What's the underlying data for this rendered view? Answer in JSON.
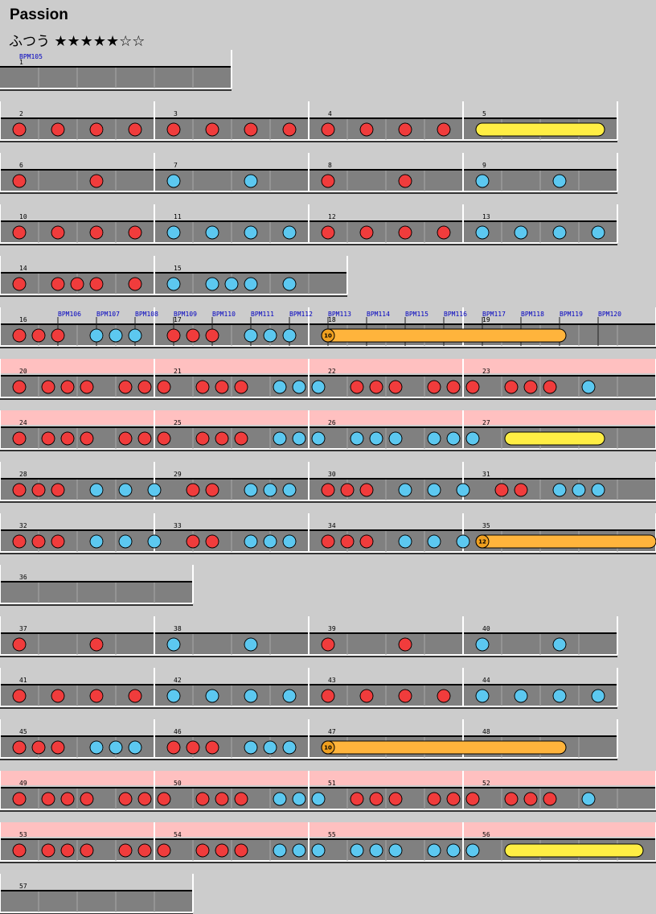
{
  "song": {
    "title": "Passion"
  },
  "difficulty": {
    "course": "ふつう",
    "stars": "★★★★★☆☆"
  },
  "colors": {
    "background": "#cccccc",
    "lane": "#808080",
    "gogo": "#ffc0c0",
    "don": "#f03c3c",
    "ka": "#5cc8f0",
    "drumroll": "#ffee44",
    "balloon": "#ffb43c",
    "barline": "#ffffff"
  },
  "icon_names": [
    "don-note-icon",
    "ka-note-icon",
    "drumroll-icon",
    "balloon-icon"
  ],
  "rows": [
    {
      "beats": 6,
      "gogo": false,
      "measures": [
        {
          "num": "1",
          "bpm": "BPM105",
          "beats": 6
        }
      ],
      "notes": [],
      "rolls": [],
      "bpm_marks": []
    },
    {
      "beats": 16,
      "gogo": false,
      "measures": [
        {
          "num": "2",
          "beats": 4
        },
        {
          "num": "3",
          "beats": 4
        },
        {
          "num": "4",
          "beats": 4
        },
        {
          "num": "5",
          "beats": 4
        }
      ],
      "notes": [
        [
          0,
          "d"
        ],
        [
          1,
          "d"
        ],
        [
          2,
          "d"
        ],
        [
          3,
          "d"
        ],
        [
          4,
          "d"
        ],
        [
          5,
          "d"
        ],
        [
          6,
          "d"
        ],
        [
          7,
          "d"
        ],
        [
          8,
          "d"
        ],
        [
          9,
          "d"
        ],
        [
          10,
          "d"
        ],
        [
          11,
          "d"
        ]
      ],
      "rolls": [
        {
          "type": "roll",
          "start": 12,
          "end": 15
        }
      ],
      "bpm_marks": []
    },
    {
      "beats": 16,
      "gogo": false,
      "measures": [
        {
          "num": "6",
          "beats": 4
        },
        {
          "num": "7",
          "beats": 4
        },
        {
          "num": "8",
          "beats": 4
        },
        {
          "num": "9",
          "beats": 4
        }
      ],
      "notes": [
        [
          0,
          "d"
        ],
        [
          2,
          "d"
        ],
        [
          4,
          "k"
        ],
        [
          6,
          "k"
        ],
        [
          8,
          "d"
        ],
        [
          10,
          "d"
        ],
        [
          12,
          "k"
        ],
        [
          14,
          "k"
        ]
      ],
      "rolls": [],
      "bpm_marks": []
    },
    {
      "beats": 16,
      "gogo": false,
      "measures": [
        {
          "num": "10",
          "beats": 4
        },
        {
          "num": "11",
          "beats": 4
        },
        {
          "num": "12",
          "beats": 4
        },
        {
          "num": "13",
          "beats": 4
        }
      ],
      "notes": [
        [
          0,
          "d"
        ],
        [
          1,
          "d"
        ],
        [
          2,
          "d"
        ],
        [
          3,
          "d"
        ],
        [
          4,
          "k"
        ],
        [
          5,
          "k"
        ],
        [
          6,
          "k"
        ],
        [
          7,
          "k"
        ],
        [
          8,
          "d"
        ],
        [
          9,
          "d"
        ],
        [
          10,
          "d"
        ],
        [
          11,
          "d"
        ],
        [
          12,
          "k"
        ],
        [
          13,
          "k"
        ],
        [
          14,
          "k"
        ],
        [
          15,
          "k"
        ]
      ],
      "rolls": [],
      "bpm_marks": []
    },
    {
      "beats": 9,
      "gogo": false,
      "measures": [
        {
          "num": "14",
          "beats": 4
        },
        {
          "num": "15",
          "beats": 5
        }
      ],
      "notes": [
        [
          0,
          "d"
        ],
        [
          1,
          "d"
        ],
        [
          1.5,
          "d"
        ],
        [
          2,
          "d"
        ],
        [
          3,
          "d"
        ],
        [
          4,
          "k"
        ],
        [
          5,
          "k"
        ],
        [
          5.5,
          "k"
        ],
        [
          6,
          "k"
        ],
        [
          7,
          "k"
        ]
      ],
      "rolls": [],
      "bpm_marks": []
    },
    {
      "beats": 17,
      "gogo": false,
      "measures": [
        {
          "num": "16",
          "beats": 4
        },
        {
          "num": "17",
          "beats": 4
        },
        {
          "num": "18",
          "beats": 4
        },
        {
          "num": "19",
          "beats": 5
        }
      ],
      "notes": [
        [
          0,
          "d"
        ],
        [
          0.5,
          "d"
        ],
        [
          1,
          "d"
        ],
        [
          2,
          "k"
        ],
        [
          2.5,
          "k"
        ],
        [
          3,
          "k"
        ],
        [
          4,
          "d"
        ],
        [
          4.5,
          "d"
        ],
        [
          5,
          "d"
        ],
        [
          6,
          "k"
        ],
        [
          6.5,
          "k"
        ],
        [
          7,
          "k"
        ]
      ],
      "rolls": [
        {
          "type": "balloon",
          "start": 8,
          "end": 14,
          "count": "10"
        }
      ],
      "bpm_marks": [
        {
          "pos": 1,
          "label": "BPM106"
        },
        {
          "pos": 2,
          "label": "BPM107"
        },
        {
          "pos": 3,
          "label": "BPM108"
        },
        {
          "pos": 4,
          "label": "BPM109"
        },
        {
          "pos": 5,
          "label": "BPM110"
        },
        {
          "pos": 6,
          "label": "BPM111"
        },
        {
          "pos": 7,
          "label": "BPM112"
        },
        {
          "pos": 8,
          "label": "BPM113"
        },
        {
          "pos": 9,
          "label": "BPM114"
        },
        {
          "pos": 10,
          "label": "BPM115"
        },
        {
          "pos": 11,
          "label": "BPM116"
        },
        {
          "pos": 12,
          "label": "BPM117"
        },
        {
          "pos": 13,
          "label": "BPM118"
        },
        {
          "pos": 14,
          "label": "BPM119"
        },
        {
          "pos": 15,
          "label": "BPM120"
        }
      ]
    },
    {
      "beats": 17,
      "gogo": true,
      "measures": [
        {
          "num": "20",
          "beats": 4
        },
        {
          "num": "21",
          "beats": 4
        },
        {
          "num": "22",
          "beats": 4
        },
        {
          "num": "23",
          "beats": 5
        }
      ],
      "notes": [
        [
          0,
          "d"
        ],
        [
          0.75,
          "d"
        ],
        [
          1.25,
          "d"
        ],
        [
          1.75,
          "d"
        ],
        [
          2.75,
          "d"
        ],
        [
          3.25,
          "d"
        ],
        [
          3.75,
          "d"
        ],
        [
          4.75,
          "d"
        ],
        [
          5.25,
          "d"
        ],
        [
          5.75,
          "d"
        ],
        [
          6.75,
          "k"
        ],
        [
          7.25,
          "k"
        ],
        [
          7.75,
          "k"
        ],
        [
          8.75,
          "d"
        ],
        [
          9.25,
          "d"
        ],
        [
          9.75,
          "d"
        ],
        [
          10.75,
          "d"
        ],
        [
          11.25,
          "d"
        ],
        [
          11.75,
          "d"
        ],
        [
          12.75,
          "d"
        ],
        [
          13.25,
          "d"
        ],
        [
          13.75,
          "d"
        ],
        [
          14.75,
          "k"
        ]
      ],
      "rolls": [],
      "bpm_marks": []
    },
    {
      "beats": 17,
      "gogo": true,
      "measures": [
        {
          "num": "24",
          "beats": 4
        },
        {
          "num": "25",
          "beats": 4
        },
        {
          "num": "26",
          "beats": 4
        },
        {
          "num": "27",
          "beats": 5
        }
      ],
      "notes": [
        [
          0,
          "d"
        ],
        [
          0.75,
          "d"
        ],
        [
          1.25,
          "d"
        ],
        [
          1.75,
          "d"
        ],
        [
          2.75,
          "d"
        ],
        [
          3.25,
          "d"
        ],
        [
          3.75,
          "d"
        ],
        [
          4.75,
          "d"
        ],
        [
          5.25,
          "d"
        ],
        [
          5.75,
          "d"
        ],
        [
          6.75,
          "k"
        ],
        [
          7.25,
          "k"
        ],
        [
          7.75,
          "k"
        ],
        [
          8.75,
          "k"
        ],
        [
          9.25,
          "k"
        ],
        [
          9.75,
          "k"
        ],
        [
          10.75,
          "k"
        ],
        [
          11.25,
          "k"
        ],
        [
          11.75,
          "k"
        ]
      ],
      "rolls": [
        {
          "type": "roll",
          "start": 12.75,
          "end": 15
        }
      ],
      "bpm_marks": []
    },
    {
      "beats": 17,
      "gogo": false,
      "measures": [
        {
          "num": "28",
          "beats": 4
        },
        {
          "num": "29",
          "beats": 4
        },
        {
          "num": "30",
          "beats": 4
        },
        {
          "num": "31",
          "beats": 5
        }
      ],
      "notes": [
        [
          0,
          "d"
        ],
        [
          0.5,
          "d"
        ],
        [
          1,
          "d"
        ],
        [
          2,
          "k"
        ],
        [
          2.75,
          "k"
        ],
        [
          3.5,
          "k"
        ],
        [
          4.5,
          "d"
        ],
        [
          5,
          "d"
        ],
        [
          6,
          "k"
        ],
        [
          6.5,
          "k"
        ],
        [
          7,
          "k"
        ],
        [
          8,
          "d"
        ],
        [
          8.5,
          "d"
        ],
        [
          9,
          "d"
        ],
        [
          10,
          "k"
        ],
        [
          10.75,
          "k"
        ],
        [
          11.5,
          "k"
        ],
        [
          12.5,
          "d"
        ],
        [
          13,
          "d"
        ],
        [
          14,
          "k"
        ],
        [
          14.5,
          "k"
        ],
        [
          15,
          "k"
        ]
      ],
      "rolls": [],
      "bpm_marks": []
    },
    {
      "beats": 17,
      "gogo": false,
      "measures": [
        {
          "num": "32",
          "beats": 4
        },
        {
          "num": "33",
          "beats": 4
        },
        {
          "num": "34",
          "beats": 4
        },
        {
          "num": "35",
          "beats": 5
        }
      ],
      "notes": [
        [
          0,
          "d"
        ],
        [
          0.5,
          "d"
        ],
        [
          1,
          "d"
        ],
        [
          2,
          "k"
        ],
        [
          2.75,
          "k"
        ],
        [
          3.5,
          "k"
        ],
        [
          4.5,
          "d"
        ],
        [
          5,
          "d"
        ],
        [
          6,
          "k"
        ],
        [
          6.5,
          "k"
        ],
        [
          7,
          "k"
        ],
        [
          8,
          "d"
        ],
        [
          8.5,
          "d"
        ],
        [
          9,
          "d"
        ],
        [
          10,
          "k"
        ],
        [
          10.75,
          "k"
        ],
        [
          11.5,
          "k"
        ]
      ],
      "rolls": [
        {
          "type": "balloon",
          "start": 12,
          "end": 16.5,
          "count": "12"
        }
      ],
      "bpm_marks": []
    },
    {
      "beats": 5,
      "gogo": false,
      "measures": [
        {
          "num": "36",
          "beats": 5
        }
      ],
      "notes": [],
      "rolls": [],
      "bpm_marks": []
    },
    {
      "beats": 16,
      "gogo": false,
      "measures": [
        {
          "num": "37",
          "beats": 4
        },
        {
          "num": "38",
          "beats": 4
        },
        {
          "num": "39",
          "beats": 4
        },
        {
          "num": "40",
          "beats": 4
        }
      ],
      "notes": [
        [
          0,
          "d"
        ],
        [
          2,
          "d"
        ],
        [
          4,
          "k"
        ],
        [
          6,
          "k"
        ],
        [
          8,
          "d"
        ],
        [
          10,
          "d"
        ],
        [
          12,
          "k"
        ],
        [
          14,
          "k"
        ]
      ],
      "rolls": [],
      "bpm_marks": []
    },
    {
      "beats": 16,
      "gogo": false,
      "measures": [
        {
          "num": "41",
          "beats": 4
        },
        {
          "num": "42",
          "beats": 4
        },
        {
          "num": "43",
          "beats": 4
        },
        {
          "num": "44",
          "beats": 4
        }
      ],
      "notes": [
        [
          0,
          "d"
        ],
        [
          1,
          "d"
        ],
        [
          2,
          "d"
        ],
        [
          3,
          "d"
        ],
        [
          4,
          "k"
        ],
        [
          5,
          "k"
        ],
        [
          6,
          "k"
        ],
        [
          7,
          "k"
        ],
        [
          8,
          "d"
        ],
        [
          9,
          "d"
        ],
        [
          10,
          "d"
        ],
        [
          11,
          "d"
        ],
        [
          12,
          "k"
        ],
        [
          13,
          "k"
        ],
        [
          14,
          "k"
        ],
        [
          15,
          "k"
        ]
      ],
      "rolls": [],
      "bpm_marks": []
    },
    {
      "beats": 16,
      "gogo": false,
      "measures": [
        {
          "num": "45",
          "beats": 4
        },
        {
          "num": "46",
          "beats": 4
        },
        {
          "num": "47",
          "beats": 4
        },
        {
          "num": "48",
          "beats": 4
        }
      ],
      "notes": [
        [
          0,
          "d"
        ],
        [
          0.5,
          "d"
        ],
        [
          1,
          "d"
        ],
        [
          2,
          "k"
        ],
        [
          2.5,
          "k"
        ],
        [
          3,
          "k"
        ],
        [
          4,
          "d"
        ],
        [
          4.5,
          "d"
        ],
        [
          5,
          "d"
        ],
        [
          6,
          "k"
        ],
        [
          6.5,
          "k"
        ],
        [
          7,
          "k"
        ]
      ],
      "rolls": [
        {
          "type": "balloon",
          "start": 8,
          "end": 14,
          "count": "10"
        }
      ],
      "bpm_marks": []
    },
    {
      "beats": 17,
      "gogo": true,
      "measures": [
        {
          "num": "49",
          "beats": 4
        },
        {
          "num": "50",
          "beats": 4
        },
        {
          "num": "51",
          "beats": 4
        },
        {
          "num": "52",
          "beats": 5
        }
      ],
      "notes": [
        [
          0,
          "d"
        ],
        [
          0.75,
          "d"
        ],
        [
          1.25,
          "d"
        ],
        [
          1.75,
          "d"
        ],
        [
          2.75,
          "d"
        ],
        [
          3.25,
          "d"
        ],
        [
          3.75,
          "d"
        ],
        [
          4.75,
          "d"
        ],
        [
          5.25,
          "d"
        ],
        [
          5.75,
          "d"
        ],
        [
          6.75,
          "k"
        ],
        [
          7.25,
          "k"
        ],
        [
          7.75,
          "k"
        ],
        [
          8.75,
          "d"
        ],
        [
          9.25,
          "d"
        ],
        [
          9.75,
          "d"
        ],
        [
          10.75,
          "d"
        ],
        [
          11.25,
          "d"
        ],
        [
          11.75,
          "d"
        ],
        [
          12.75,
          "d"
        ],
        [
          13.25,
          "d"
        ],
        [
          13.75,
          "d"
        ],
        [
          14.75,
          "k"
        ]
      ],
      "rolls": [],
      "bpm_marks": []
    },
    {
      "beats": 17,
      "gogo": true,
      "measures": [
        {
          "num": "53",
          "beats": 4
        },
        {
          "num": "54",
          "beats": 4
        },
        {
          "num": "55",
          "beats": 4
        },
        {
          "num": "56",
          "beats": 5
        }
      ],
      "notes": [
        [
          0,
          "d"
        ],
        [
          0.75,
          "d"
        ],
        [
          1.25,
          "d"
        ],
        [
          1.75,
          "d"
        ],
        [
          2.75,
          "d"
        ],
        [
          3.25,
          "d"
        ],
        [
          3.75,
          "d"
        ],
        [
          4.75,
          "d"
        ],
        [
          5.25,
          "d"
        ],
        [
          5.75,
          "d"
        ],
        [
          6.75,
          "k"
        ],
        [
          7.25,
          "k"
        ],
        [
          7.75,
          "k"
        ],
        [
          8.75,
          "k"
        ],
        [
          9.25,
          "k"
        ],
        [
          9.75,
          "k"
        ],
        [
          10.75,
          "k"
        ],
        [
          11.25,
          "k"
        ],
        [
          11.75,
          "k"
        ]
      ],
      "rolls": [
        {
          "type": "roll",
          "start": 12.75,
          "end": 16
        }
      ],
      "bpm_marks": []
    },
    {
      "beats": 5,
      "gogo": false,
      "measures": [
        {
          "num": "57",
          "beats": 5
        }
      ],
      "notes": [],
      "rolls": [],
      "bpm_marks": []
    }
  ]
}
